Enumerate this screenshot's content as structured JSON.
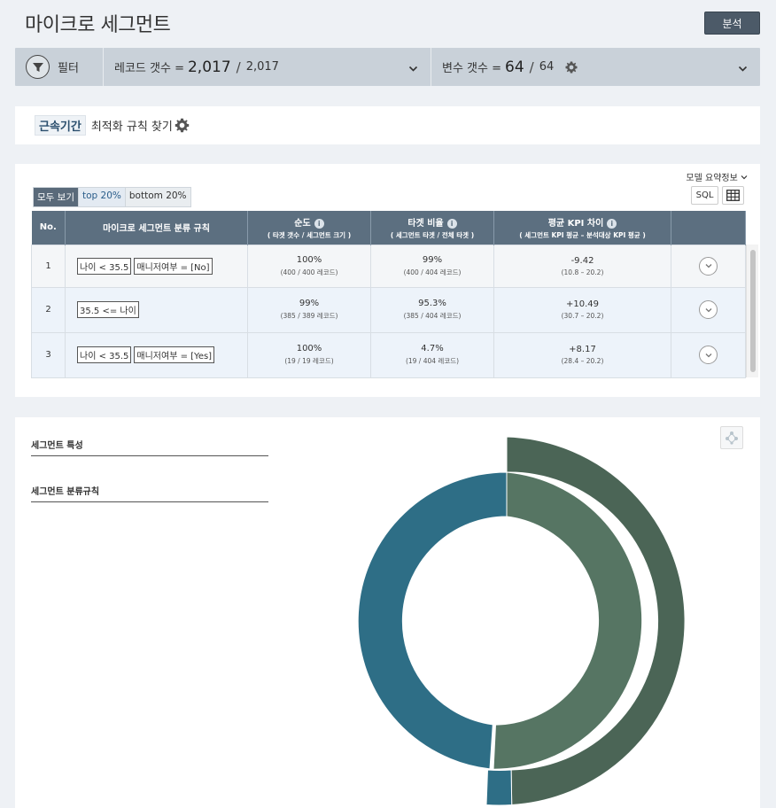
{
  "page": {
    "title": "마이크로 세그먼트",
    "analyze_label": "분석"
  },
  "filterbar": {
    "filter_label": "필터",
    "record_label": "레코드 갯수 =",
    "record_value": "2,017",
    "record_total": "2,017",
    "variable_label": "변수 갯수 =",
    "variable_value": "64",
    "variable_total": "64"
  },
  "optimize": {
    "chip": "근속기간",
    "text": "최적화 규칙 찾기"
  },
  "table_panel": {
    "model_info": "모델 요약정보",
    "sql_label": "SQL",
    "tabs": [
      "모두 보기",
      "top 20%",
      "bottom 20%"
    ],
    "headers": {
      "no": "No.",
      "rule": "마이크로 세그먼트 분류 규칙",
      "purity": "순도",
      "purity_sub": "( 타겟 갯수 / 세그먼트 크기 )",
      "target": "타겟 비율",
      "target_sub": "( 세그먼트 타겟 / 전체 타겟 )",
      "kpi": "평균 KPI 차이",
      "kpi_sub": "( 세그먼트 KPI 평균 – 분석대상 KPI 평균 )"
    },
    "rows": [
      {
        "no": "1",
        "rules": [
          "나이 < 35.5",
          "매니저여부 = [No]"
        ],
        "purity": "100%",
        "purity_detail": "(400 / 400 레코드)",
        "target": "99%",
        "target_detail": "(400 / 404 레코드)",
        "kpi": "-9.42",
        "kpi_detail": "(10.8 – 20.2)"
      },
      {
        "no": "2",
        "rules": [
          "35.5 <= 나이"
        ],
        "purity": "99%",
        "purity_detail": "(385 / 389 레코드)",
        "target": "95.3%",
        "target_detail": "(385 / 404 레코드)",
        "kpi": "+10.49",
        "kpi_detail": "(30.7 – 20.2)"
      },
      {
        "no": "3",
        "rules": [
          "나이 < 35.5",
          "매니저여부 = [Yes]"
        ],
        "purity": "100%",
        "purity_detail": "(19 / 19 레코드)",
        "target": "4.7%",
        "target_detail": "(19 / 404 레코드)",
        "kpi": "+8.17",
        "kpi_detail": "(28.4 – 20.2)"
      }
    ]
  },
  "detail_panel": {
    "feature_label": "세그먼트 특성",
    "rule_label": "세그먼트 분류규칙"
  },
  "colors": {
    "header": "#5c6f80",
    "dark_green": "#4b6556",
    "mid_green": "#567563",
    "teal": "#2e6e86",
    "button": "#4c5a68"
  }
}
